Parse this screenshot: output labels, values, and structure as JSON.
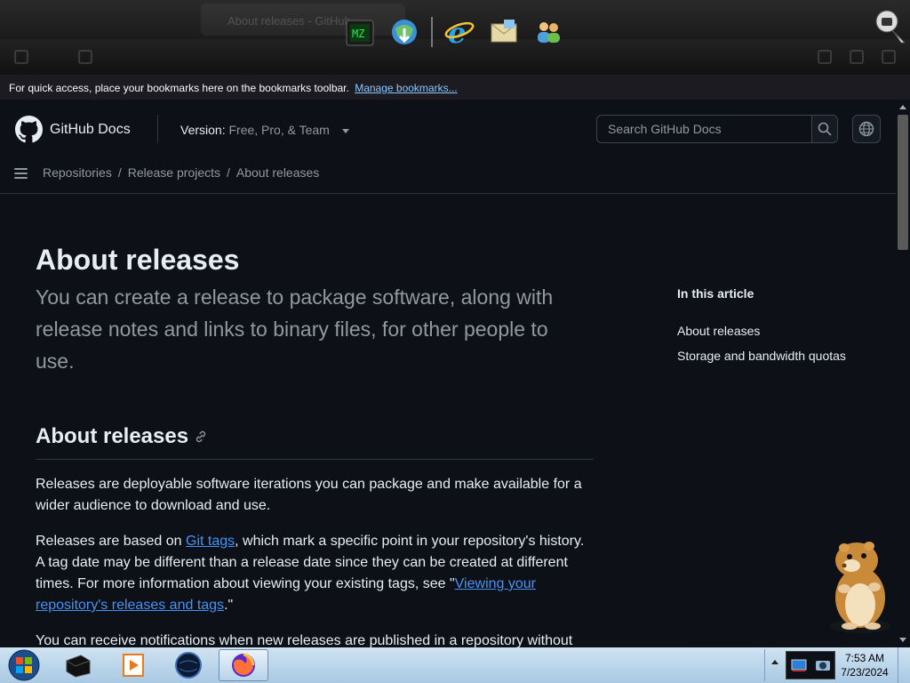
{
  "browser": {
    "ghost_tab_text": "About releases - GitHub",
    "bookmarks_bar": {
      "message": "For quick access, place your bookmarks here on the bookmarks toolbar.",
      "link": "Manage bookmarks..."
    },
    "dock_icons": [
      "matrix-app-icon",
      "download-globe-icon",
      "internet-explorer-icon",
      "mail-envelope-icon",
      "users-icon"
    ]
  },
  "header": {
    "brand": "GitHub Docs",
    "version_label": "Version:",
    "version_value": "Free, Pro, & Team",
    "search_placeholder": "Search GitHub Docs"
  },
  "breadcrumb": [
    "Repositories",
    "Release projects",
    "About releases"
  ],
  "article": {
    "title": "About releases",
    "intro": "You can create a release to package software, along with release notes and links to binary files, for other people to use.",
    "section_heading": "About releases",
    "paragraphs": {
      "p1": "Releases are deployable software iterations you can package and make available for a wider audience to download and use.",
      "p2_a": "Releases are based on ",
      "p2_link1": "Git tags",
      "p2_b": ", which mark a specific point in your repository's history. A tag date may be different than a release date since they can be created at different times. For more information about viewing your existing tags, see \"",
      "p2_link2": "Viewing your repository's releases and tags",
      "p2_c": ".\"",
      "p3": "You can receive notifications when new releases are published in a repository without"
    }
  },
  "toc": {
    "title": "In this article",
    "items": [
      "About releases",
      "Storage and bandwidth quotas"
    ]
  },
  "taskbar": {
    "apps": [
      "terminal-app-icon",
      "media-player-icon",
      "globe-browser-icon",
      "firefox-icon"
    ],
    "clock_time": "7:53 AM",
    "clock_date": "7/23/2024"
  },
  "colors": {
    "page_bg": "#0d1117",
    "text": "#e6edf3",
    "muted": "#9198a1",
    "link": "#4493f8",
    "border": "#30363d"
  }
}
